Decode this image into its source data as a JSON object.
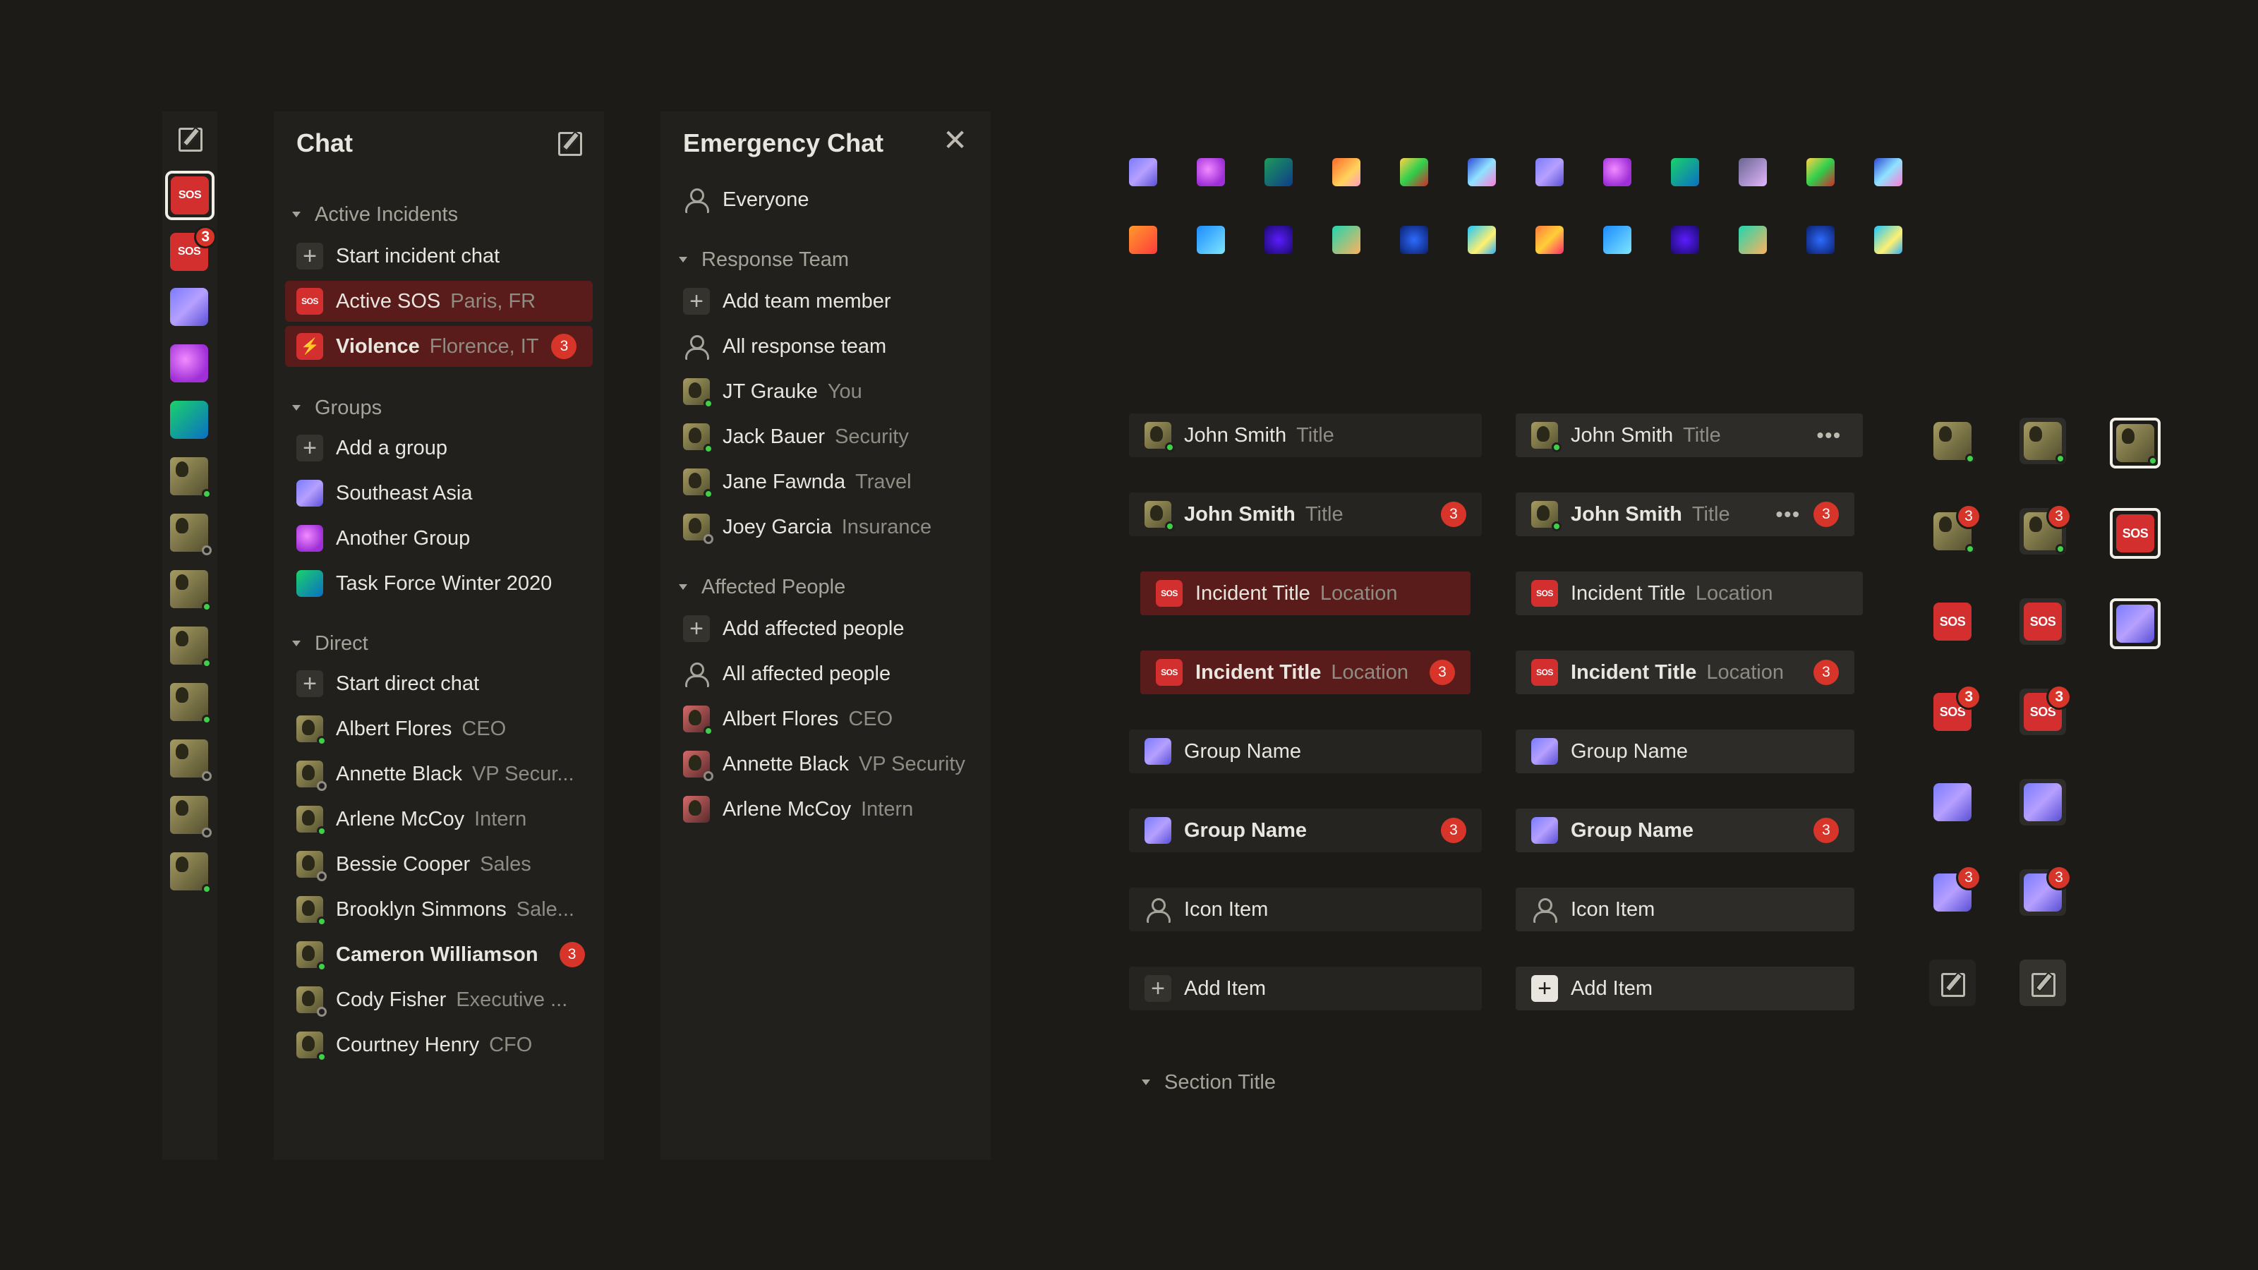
{
  "chat": {
    "title": "Chat",
    "active_incidents": "Active Incidents",
    "start_incident": "Start incident chat",
    "incidents": [
      {
        "label": "Active SOS",
        "sub": "Paris, FR"
      },
      {
        "label": "Violence",
        "sub": "Florence, IT",
        "badge": "3"
      }
    ],
    "sos_icon_label": "SOS",
    "groups": "Groups",
    "add_group": "Add a group",
    "group_items": [
      "Southeast Asia",
      "Another Group",
      "Task Force Winter 2020"
    ],
    "direct": "Direct",
    "start_direct": "Start direct chat",
    "contacts": [
      {
        "name": "Albert Flores",
        "sub": "CEO"
      },
      {
        "name": "Annette Black",
        "sub": "VP Secur..."
      },
      {
        "name": "Arlene McCoy",
        "sub": "Intern"
      },
      {
        "name": "Bessie Cooper",
        "sub": "Sales"
      },
      {
        "name": "Brooklyn Simmons",
        "sub": "Sale..."
      },
      {
        "name": "Cameron Williamson",
        "sub": "",
        "badge": "3"
      },
      {
        "name": "Cody Fisher",
        "sub": "Executive ..."
      },
      {
        "name": "Courtney Henry",
        "sub": "CFO"
      }
    ]
  },
  "rail": {
    "sos": "SOS",
    "sos_badge": "3"
  },
  "emergency": {
    "title": "Emergency Chat",
    "everyone": "Everyone",
    "response_team": "Response Team",
    "add_team": "Add team member",
    "all_team": "All response team",
    "team": [
      {
        "name": "JT Grauke",
        "sub": "You"
      },
      {
        "name": "Jack Bauer",
        "sub": "Security"
      },
      {
        "name": "Jane Fawnda",
        "sub": "Travel"
      },
      {
        "name": "Joey Garcia",
        "sub": "Insurance"
      }
    ],
    "affected": "Affected People",
    "add_affected": "Add affected people",
    "all_affected": "All affected people",
    "people": [
      {
        "name": "Albert Flores",
        "sub": "CEO"
      },
      {
        "name": "Annette Black",
        "sub": "VP Security"
      },
      {
        "name": "Arlene McCoy",
        "sub": "Intern"
      }
    ]
  },
  "components": {
    "name": "John Smith",
    "title": "Title",
    "incident": "Incident Title",
    "location": "Location",
    "group": "Group Name",
    "icon_item": "Icon Item",
    "add_item": "Add Item",
    "badge": "3",
    "sos": "SOS",
    "section": "Section Title"
  },
  "colors": {
    "background": "#1c1b17",
    "panel": "#21201c",
    "sos_red": "#d42f2f",
    "badge_red": "#d8352a",
    "online": "#3fd04a"
  }
}
